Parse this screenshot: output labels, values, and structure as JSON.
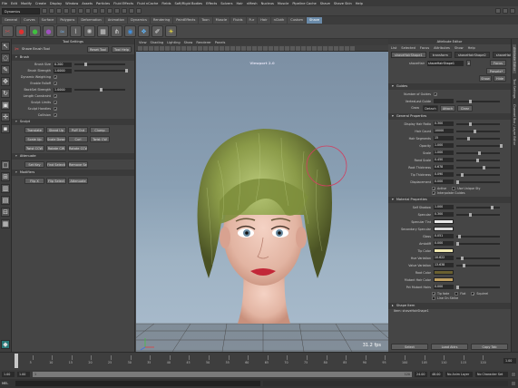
{
  "menubar": [
    "File",
    "Edit",
    "Modify",
    "Create",
    "Display",
    "Window",
    "Assets",
    "Particles",
    "Fluid Effects",
    "Fluid nCache",
    "Fields",
    "Soft/Rigid Bodies",
    "Effects",
    "Solvers",
    "Hair",
    "nMesh",
    "Nucleus",
    "Muscle",
    "Pipeline Cache",
    "Shave",
    "Shave Skin",
    "Help"
  ],
  "status": {
    "mode": "Dynamics"
  },
  "shelf_tabs": [
    "General",
    "Curves",
    "Surface",
    "Polygons",
    "Deformation",
    "Animation",
    "Dynamics",
    "Rendering",
    "PaintEffects",
    "Toon",
    "Muscle",
    "Fluids",
    "Fur",
    "Hair",
    "nCloth",
    "Custom",
    "Shave"
  ],
  "shelf_active": "Shave",
  "shelf_icons": [
    {
      "name": "shave-icon",
      "glyph": "✂",
      "color": "#c05050"
    },
    {
      "name": "red-sphere-icon",
      "glyph": "●",
      "color": "#e03030"
    },
    {
      "name": "green-sphere-icon",
      "glyph": "●",
      "color": "#40c040"
    },
    {
      "name": "purple-sphere-icon",
      "glyph": "●",
      "color": "#a050c0"
    },
    {
      "name": "wave-icon",
      "glyph": "≈",
      "color": "#70a0d0"
    },
    {
      "name": "hair-tool-icon",
      "glyph": "⌇",
      "color": "#d0d0d0"
    },
    {
      "name": "wind-icon",
      "glyph": "✺",
      "color": "#c0c0c0"
    },
    {
      "name": "grid-icon",
      "glyph": "▦",
      "color": "#d0d0d0"
    },
    {
      "name": "comb-icon",
      "glyph": "⋔",
      "color": "#d0d0d0"
    },
    {
      "name": "render-icon",
      "glyph": "◉",
      "color": "#4090e0"
    },
    {
      "name": "texture-icon",
      "glyph": "❖",
      "color": "#60b0f0"
    },
    {
      "name": "brush-icon",
      "glyph": "✐",
      "color": "#e0e0e0"
    },
    {
      "name": "light-bulb-icon",
      "glyph": "☀",
      "color": "#f0e040"
    }
  ],
  "tool_settings": {
    "title": "Tool Settings",
    "tool_name": "Shave Brush Tool",
    "reset_label": "Reset Tool",
    "help_label": "Tool Help",
    "brush_section": "Brush",
    "brush_fields": [
      {
        "label": "Brush Size",
        "value": "0.200",
        "pos": 0.2
      },
      {
        "label": "Brush Strength",
        "value": "1.0000",
        "pos": 1.0
      },
      {
        "label": "Dynamic Weighting",
        "value": "",
        "pos": null
      },
      {
        "label": "Enable Falloff",
        "value": "",
        "pos": null
      },
      {
        "label": "BackSet Strength",
        "value": "1.0000",
        "pos": 0.5
      },
      {
        "label": "Length Constraint",
        "value": "",
        "pos": null
      },
      {
        "label": "Sculpt Limits",
        "value": "",
        "pos": null
      },
      {
        "label": "Sculpt Handles",
        "value": "",
        "pos": null
      },
      {
        "label": "Collision",
        "value": "",
        "pos": null
      }
    ],
    "sculpt_section": "Sculpt",
    "sculpt_buttons": [
      "Translate",
      "Stand Up",
      "Puff Out",
      "Clump",
      "Scale Up",
      "Scale Down",
      "Curl",
      "Twist CW",
      "Twist CCW",
      "Rotate CW",
      "Rotate CCW"
    ],
    "attenuate_section": "Attenuate",
    "attenuate_buttons": [
      "Set Key",
      "Find Selection",
      "Remove Selected"
    ],
    "modifiers_section": "Modifiers",
    "modifiers_buttons": [
      "Flip X",
      "Flip Select",
      "Attenuate"
    ]
  },
  "viewport": {
    "menu": [
      "View",
      "Shading",
      "Lighting",
      "Show",
      "Renderer",
      "Panels"
    ],
    "label": "Viewport 2.0",
    "fps": "31.2 fps"
  },
  "attribute_editor": {
    "title": "Attribute Editor",
    "menu": [
      "List",
      "Selected",
      "Focus",
      "Attributes",
      "Show",
      "Help"
    ],
    "tabs": [
      "shaveHairShape1",
      "transform",
      "shaveHairShape2",
      "shaveHair1_p_xfr"
    ],
    "active_tab": "shaveHairShape1",
    "node_label": "shaveHair",
    "node_value": "shaveHairShape1",
    "focus_label": "Focus",
    "presets_label": "Presets*",
    "show_label": "Show",
    "hide_label": "Hide",
    "guides_section": "Guides",
    "guide_fields": [
      {
        "label": "Number of Guides",
        "value": "",
        "pos": null
      },
      {
        "label": "VertexLast Guide",
        "value": "",
        "pos": 0.3
      }
    ],
    "grow_label": "Grow",
    "grow_buttons": [
      "Detach",
      "Attach",
      "Clear"
    ],
    "general_section": "General Properties",
    "general_fields": [
      {
        "label": "Display Hair Ratio",
        "value": "0.300",
        "pos": 0.3
      },
      {
        "label": "Hair Count",
        "value": "10000",
        "pos": 0.4
      },
      {
        "label": "Hair Segments",
        "value": "15",
        "pos": 0.25
      },
      {
        "label": "Opacity",
        "value": "1.000",
        "pos": 1.0
      },
      {
        "label": "Scale",
        "value": "1.000",
        "pos": 0.5
      },
      {
        "label": "Rand Scale",
        "value": "0.450",
        "pos": 0.45
      },
      {
        "label": "Root Thickness",
        "value": "0.678",
        "pos": 0.6
      },
      {
        "label": "Tip Thickness",
        "value": "0.090",
        "pos": 0.1
      },
      {
        "label": "Displacement",
        "value": "0.000",
        "pos": 0.0
      }
    ],
    "edit_label": "Edit",
    "checks": [
      {
        "label": "Active",
        "checked": true
      },
      {
        "label": "Use Unique Sty",
        "checked": false
      },
      {
        "label": "Interpolate Guides",
        "checked": true
      }
    ],
    "material_section": "Material Properties",
    "material_fields": [
      {
        "label": "Self Shadow",
        "value": "1.000",
        "pos": 0.8
      },
      {
        "label": "Specular",
        "value": "0.300",
        "pos": 0.3
      },
      {
        "label": "Specular Tint",
        "value": "",
        "color": "#e8e8e8"
      },
      {
        "label": "Secondary Specular",
        "value": "",
        "color": "#d8d8d8"
      },
      {
        "label": "Gloss",
        "value": "0.051",
        "pos": 0.05
      },
      {
        "label": "Ambdiff",
        "value": "0.000",
        "pos": 0.0
      },
      {
        "label": "Tip Color",
        "value": "",
        "color": "#f0e8b0"
      },
      {
        "label": "Hue Variation",
        "value": "10.622",
        "pos": 0.1
      },
      {
        "label": "Value Variation",
        "value": "13.638",
        "pos": 0.14
      },
      {
        "label": "Root Color",
        "value": "",
        "color": "#6a6030"
      },
      {
        "label": "Mutant Hair Color",
        "value": "",
        "color": "#c0a060"
      },
      {
        "label": "Pct Mutant Hairs",
        "value": "0.000",
        "pos": 0.0
      }
    ],
    "flag_checks": [
      {
        "label": "Tip fade",
        "checked": true
      },
      {
        "label": "Flat",
        "checked": false
      },
      {
        "label": "Squirrel",
        "checked": true
      },
      {
        "label": "Line On Strike",
        "checked": false
      }
    ],
    "shape_section": "Shape Item",
    "notes_label": "Item: shaveHairShape1",
    "bottom_buttons": [
      "Select",
      "Load Attrs",
      "Copy Tab"
    ]
  },
  "side_strip": [
    "Attribute Editor",
    "Tool Settings",
    "Channel Box / Layer Editor"
  ],
  "timeline": {
    "ticks": [
      "5",
      "10",
      "15",
      "20",
      "25",
      "30",
      "35",
      "40",
      "45",
      "50",
      "55",
      "60",
      "65",
      "70",
      "75",
      "80",
      "85",
      "90",
      "95",
      "100",
      "105",
      "110",
      "115",
      "120"
    ],
    "current_frame": "1.00"
  },
  "range": {
    "start": "1.00",
    "start2": "1.00",
    "range_start": "1",
    "range_end": "120",
    "end": "24.00",
    "end2": "48.00",
    "current": "1.00",
    "no_anim_layer": "No Anim Layer",
    "no_char_set": "No Character Set"
  },
  "command_line": {
    "label": "MEL"
  }
}
